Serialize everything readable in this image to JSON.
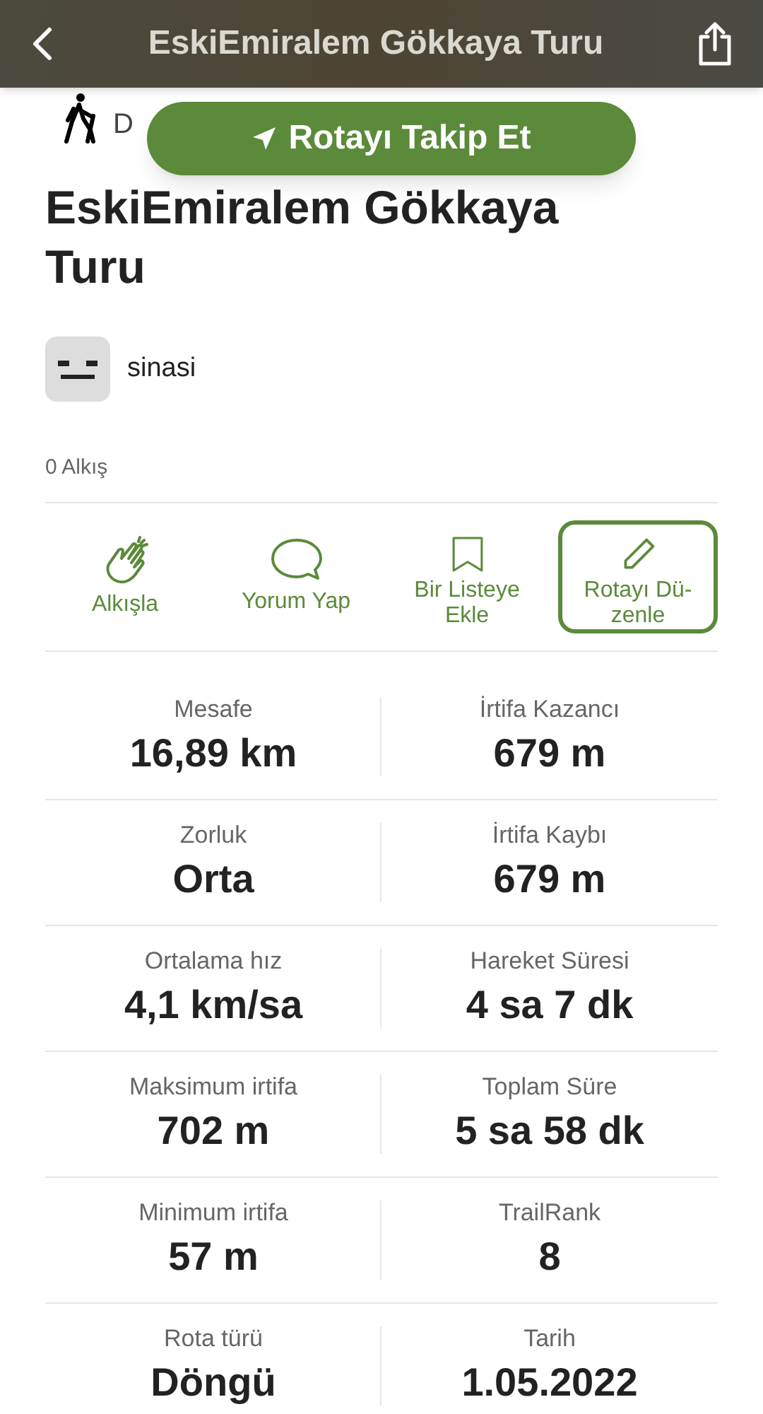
{
  "header": {
    "title": "EskiEmiralem Gökkaya Turu"
  },
  "activity": {
    "label": "D"
  },
  "follow_button": {
    "label": "Rotayı Takip Et"
  },
  "trail": {
    "title": "EskiEmiralem Gökkaya Turu",
    "author": "sinasi",
    "claps": "0 Alkış"
  },
  "actions": [
    {
      "kind": "clap",
      "label": "Alkışla",
      "selected": false
    },
    {
      "kind": "comment",
      "label": "Yorum Yap",
      "selected": false
    },
    {
      "kind": "bookmark",
      "label": "Bir Listeye Ekle",
      "selected": false
    },
    {
      "kind": "edit",
      "label": "Rotayı Dü-zenle",
      "selected": true
    }
  ],
  "stats": [
    {
      "label": "Mesafe",
      "value": "16,89 km"
    },
    {
      "label": "İrtifa Kazancı",
      "value": "679 m"
    },
    {
      "label": "Zorluk",
      "value": "Orta"
    },
    {
      "label": "İrtifa Kaybı",
      "value": "679 m"
    },
    {
      "label": "Ortalama hız",
      "value": "4,1 km/sa"
    },
    {
      "label": "Hareket Süresi",
      "value": "4 sa 7 dk"
    },
    {
      "label": "Maksimum irtifa",
      "value": "702 m"
    },
    {
      "label": "Toplam Süre",
      "value": "5 sa 58 dk"
    },
    {
      "label": "Minimum irtifa",
      "value": "57 m"
    },
    {
      "label": "TrailRank",
      "value": "8"
    },
    {
      "label": "Rota türü",
      "value": "Döngü"
    },
    {
      "label": "Tarih",
      "value": "1.05.2022"
    }
  ]
}
